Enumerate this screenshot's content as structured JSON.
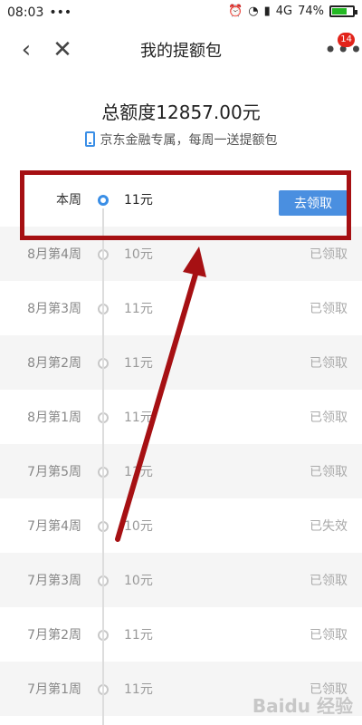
{
  "status_bar": {
    "time": "08:03",
    "dots": "•••",
    "network": "4G",
    "battery_percent": "74%",
    "battery_level": 0.74
  },
  "nav": {
    "back_icon": "‹",
    "close_icon": "✕",
    "title": "我的提额包",
    "more_icon": "•••",
    "badge_count": "14"
  },
  "summary": {
    "total_text": "总额度12857.00元",
    "subtitle": "京东金融专属，每周一送提额包"
  },
  "rows": [
    {
      "week": "本周",
      "amount": "11元",
      "status": "去领取",
      "current": true
    },
    {
      "week": "8月第4周",
      "amount": "10元",
      "status": "已领取"
    },
    {
      "week": "8月第3周",
      "amount": "11元",
      "status": "已领取"
    },
    {
      "week": "8月第2周",
      "amount": "11元",
      "status": "已领取"
    },
    {
      "week": "8月第1周",
      "amount": "11元",
      "status": "已领取"
    },
    {
      "week": "7月第5周",
      "amount": "11元",
      "status": "已领取"
    },
    {
      "week": "7月第4周",
      "amount": "10元",
      "status": "已失效"
    },
    {
      "week": "7月第3周",
      "amount": "10元",
      "status": "已领取"
    },
    {
      "week": "7月第2周",
      "amount": "11元",
      "status": "已领取"
    },
    {
      "week": "7月第1周",
      "amount": "11元",
      "status": "已领取"
    }
  ],
  "colors": {
    "accent": "#4a8fe0",
    "annotation": "#a61013",
    "badge": "#e2231a"
  },
  "watermark": "Baidu 经验"
}
